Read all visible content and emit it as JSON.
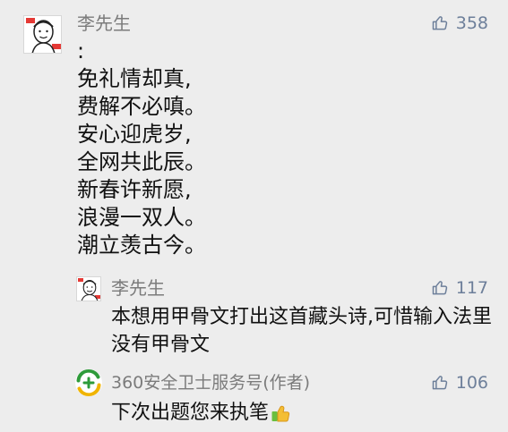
{
  "main": {
    "author": "李先生",
    "likes": "358",
    "poem_lines": [
      ":",
      "免礼情却真,",
      "费解不必嗔。",
      "安心迎虎岁,",
      "全网共此辰。",
      "新春许新愿,",
      "浪漫一双人。",
      "潮立羡古今。"
    ]
  },
  "replies": [
    {
      "author": "李先生",
      "likes": "117",
      "text": "本想用甲骨文打出这首藏头诗,可惜输入法里没有甲骨文"
    },
    {
      "author": "360安全卫士服务号(作者)",
      "likes": "106",
      "text": "下次出题您来执笔"
    }
  ],
  "colors": {
    "background": "#ededed",
    "author": "#7b7b7b",
    "likes": "#6d7f9a",
    "text": "#111111"
  },
  "icons": {
    "like": "thumb-up-icon",
    "avatar": "person-avatar-icon",
    "brand": "360-logo-icon",
    "emoji": "thumbs-up-emoji"
  }
}
